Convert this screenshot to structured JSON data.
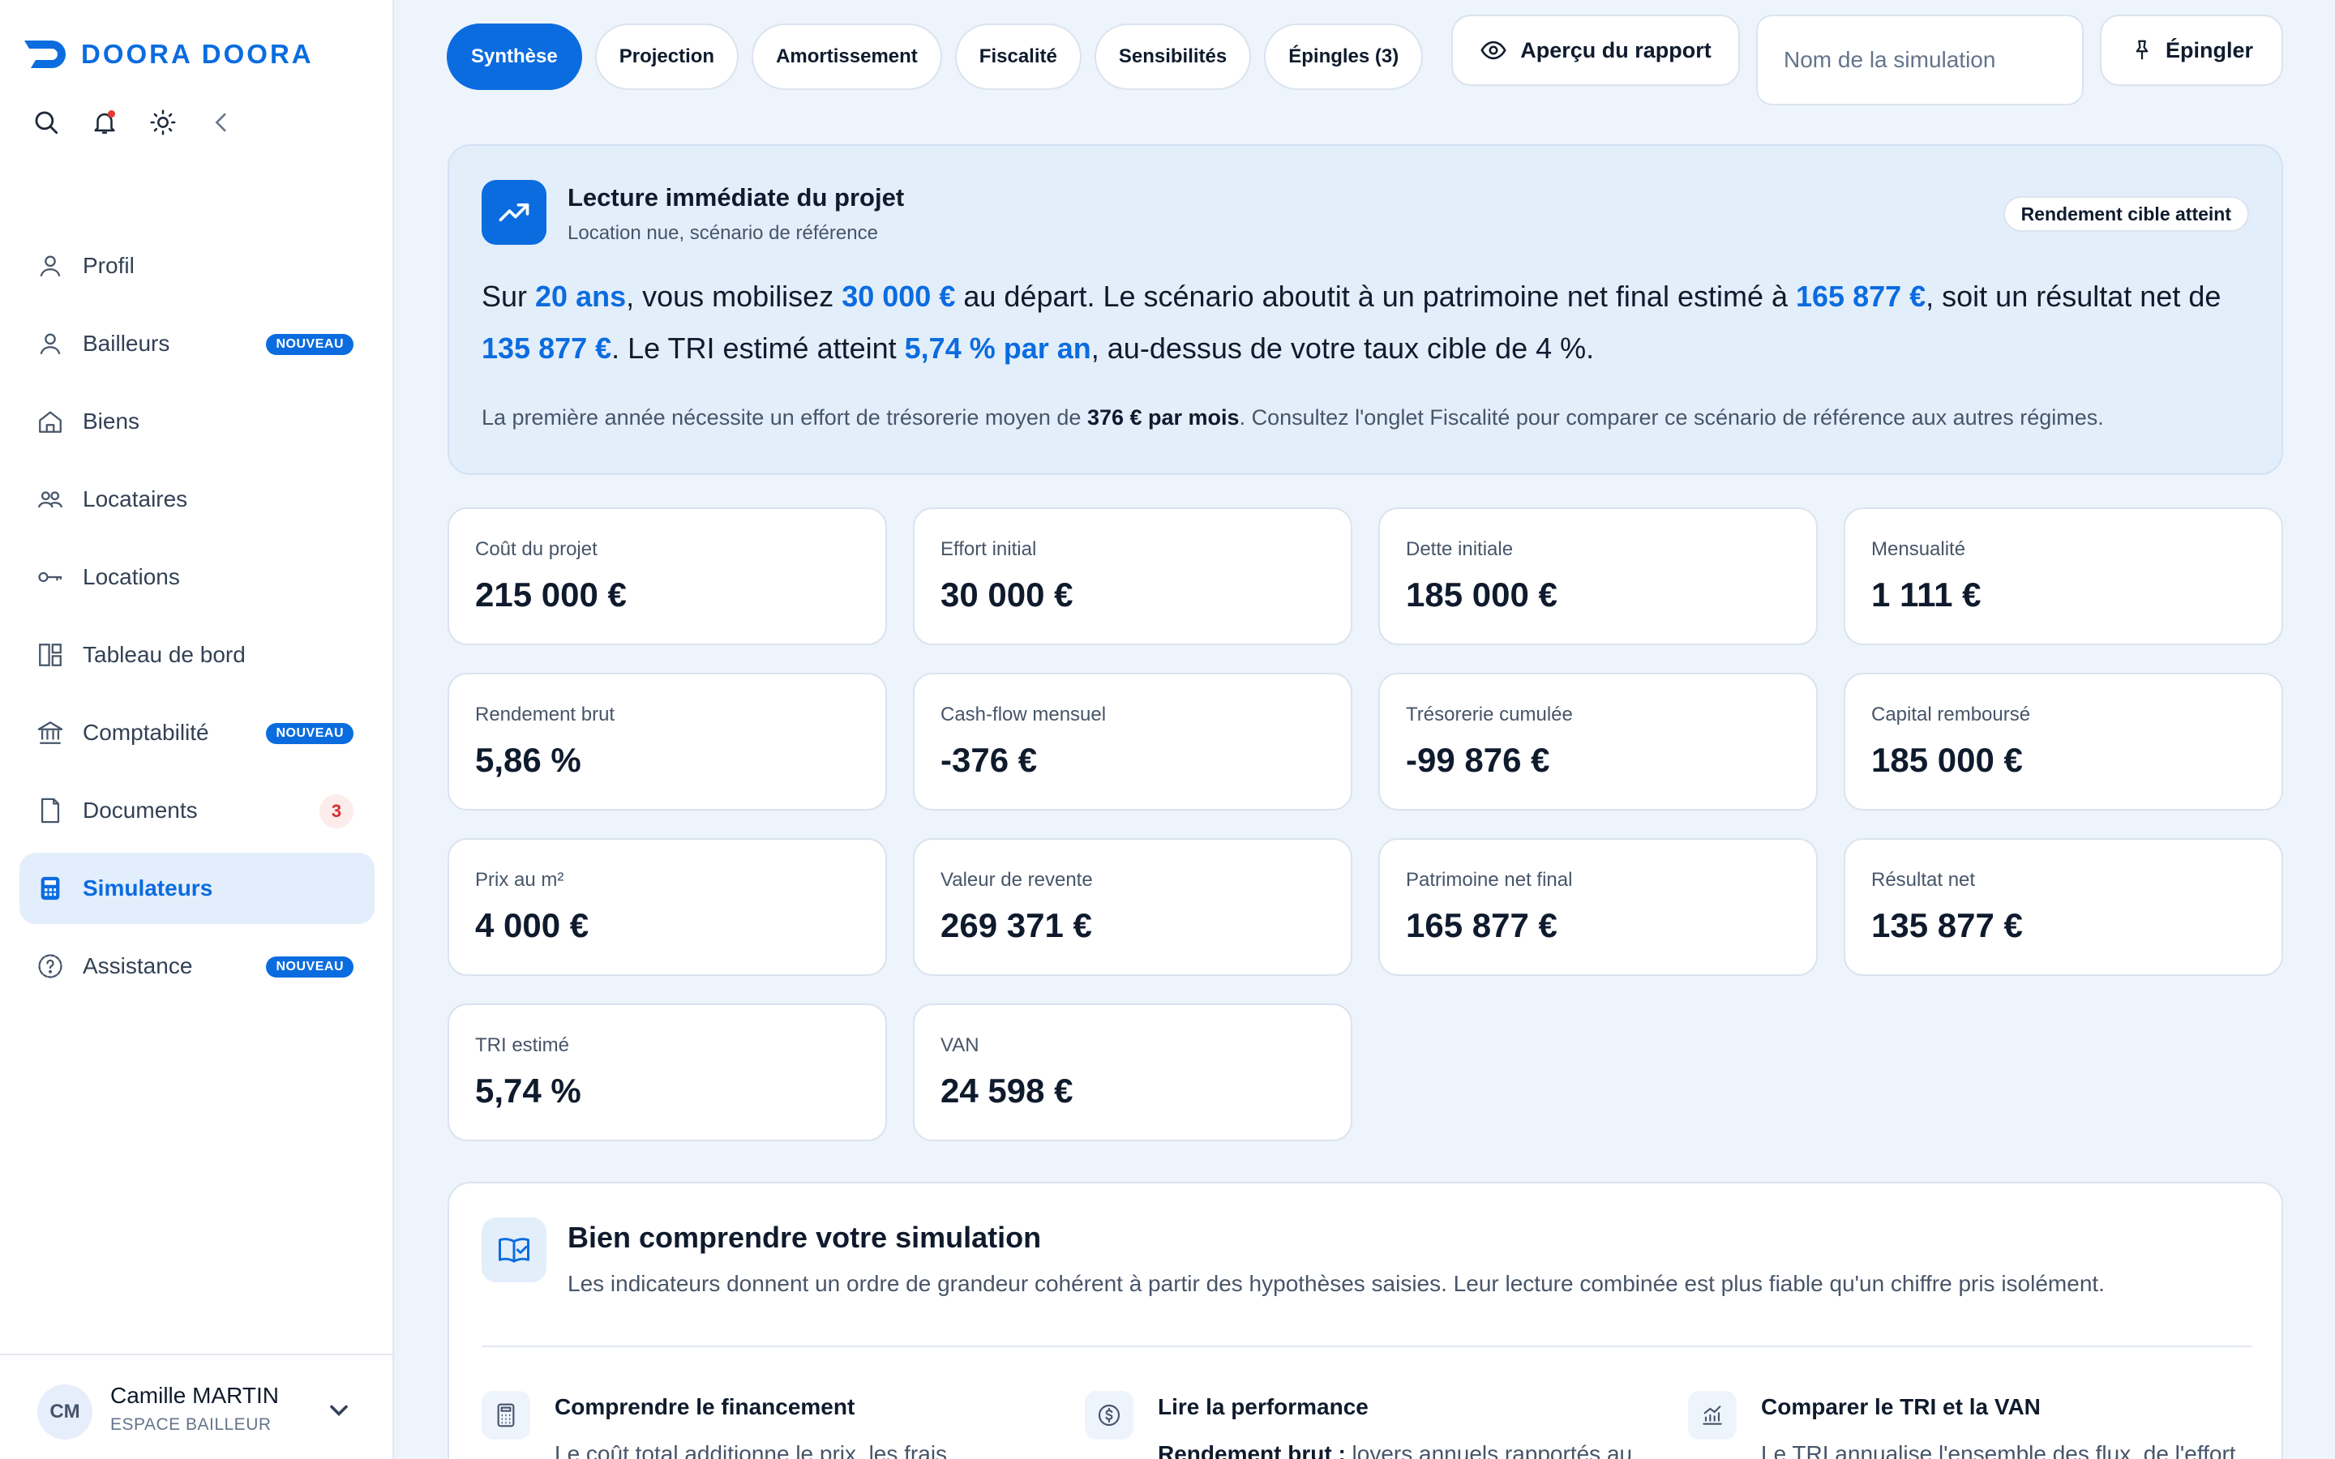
{
  "brand": {
    "name": "DOORA DOORA",
    "color": "#0b6cdf"
  },
  "sidebar": {
    "items": [
      {
        "label": "Profil",
        "icon": "user-icon"
      },
      {
        "label": "Bailleurs",
        "icon": "user-icon",
        "badge": "NOUVEAU"
      },
      {
        "label": "Biens",
        "icon": "home-icon"
      },
      {
        "label": "Locataires",
        "icon": "users-icon"
      },
      {
        "label": "Locations",
        "icon": "key-icon"
      },
      {
        "label": "Tableau de bord",
        "icon": "dashboard-icon"
      },
      {
        "label": "Comptabilité",
        "icon": "bank-icon",
        "badge": "NOUVEAU"
      },
      {
        "label": "Documents",
        "icon": "document-icon",
        "count": "3"
      },
      {
        "label": "Simulateurs",
        "icon": "calculator-icon",
        "active": true
      },
      {
        "label": "Assistance",
        "icon": "help-icon",
        "badge": "NOUVEAU"
      }
    ],
    "user": {
      "initials": "CM",
      "name": "Camille MARTIN",
      "role": "ESPACE BAILLEUR"
    }
  },
  "tabs": [
    {
      "label": "Synthèse",
      "active": true
    },
    {
      "label": "Projection"
    },
    {
      "label": "Amortissement"
    },
    {
      "label": "Fiscalité"
    },
    {
      "label": "Sensibilités"
    },
    {
      "label": "Épingles (3)"
    }
  ],
  "toolbar": {
    "preview_label": "Aperçu du rapport",
    "simulation_placeholder": "Nom de la simulation",
    "pin_label": "Épingler"
  },
  "hero": {
    "title": "Lecture immédiate du projet",
    "subtitle": "Location nue, scénario de référence",
    "badge": "Rendement cible atteint",
    "t1": "Sur ",
    "h1": "20 ans",
    "t2": ", vous mobilisez ",
    "h2": "30 000 €",
    "t3": " au départ. Le scénario aboutit à un patrimoine net final estimé à ",
    "h3": "165 877 €",
    "t4": ", soit un résultat net de ",
    "h4": "135 877 €",
    "t5": ". Le TRI estimé atteint ",
    "h5": "5,74 % par an",
    "t6": ", au-dessus de votre taux cible de 4 %.",
    "note_a": "La première année nécessite un effort de trésorerie moyen de ",
    "note_b": "376 € par mois",
    "note_c": ". Consultez l'onglet Fiscalité pour comparer ce scénario de référence aux autres régimes."
  },
  "kpis": [
    {
      "label": "Coût du projet",
      "value": "215 000 €"
    },
    {
      "label": "Effort initial",
      "value": "30 000 €"
    },
    {
      "label": "Dette initiale",
      "value": "185 000 €"
    },
    {
      "label": "Mensualité",
      "value": "1 111 €"
    },
    {
      "label": "Rendement brut",
      "value": "5,86 %"
    },
    {
      "label": "Cash-flow mensuel",
      "value": "-376 €"
    },
    {
      "label": "Trésorerie cumulée",
      "value": "-99 876 €"
    },
    {
      "label": "Capital remboursé",
      "value": "185 000 €"
    },
    {
      "label": "Prix au m²",
      "value": "4 000 €"
    },
    {
      "label": "Valeur de revente",
      "value": "269 371 €"
    },
    {
      "label": "Patrimoine net final",
      "value": "165 877 €"
    },
    {
      "label": "Résultat net",
      "value": "135 877 €"
    },
    {
      "label": "TRI estimé",
      "value": "5,74 %"
    },
    {
      "label": "VAN",
      "value": "24 598 €"
    }
  ],
  "understand": {
    "title": "Bien comprendre votre simulation",
    "desc": "Les indicateurs donnent un ordre de grandeur cohérent à partir des hypothèses saisies. Leur lecture combinée est plus fiable qu'un chiffre pris isolément.",
    "cols": [
      {
        "title": "Comprendre le financement",
        "text": "Le coût total additionne le prix, les frais"
      },
      {
        "title": "Lire la performance",
        "text_bold": "Rendement brut :",
        "text": " loyers annuels rapportés au"
      },
      {
        "title": "Comparer le TRI et la VAN",
        "text": "Le TRI annualise l'ensemble des flux, de l'effort"
      }
    ]
  }
}
